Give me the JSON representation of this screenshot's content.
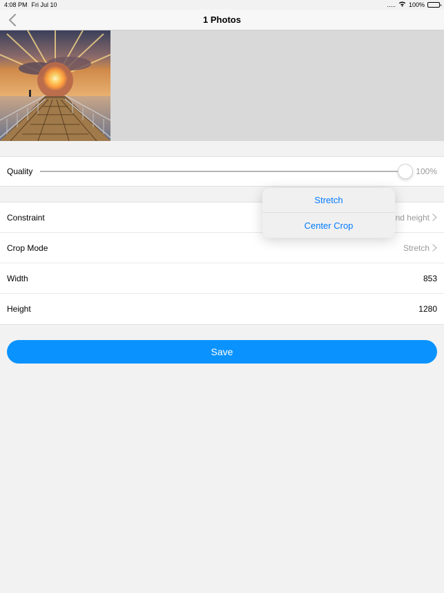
{
  "statusbar": {
    "time": "4:08 PM",
    "date": "Fri Jul 10",
    "signal_dots": ".....",
    "battery_pct": "100%"
  },
  "nav": {
    "title": "1 Photos"
  },
  "quality": {
    "label": "Quality",
    "value": "100%"
  },
  "rows": {
    "constraint": {
      "label": "Constraint",
      "value": "nd height"
    },
    "crop": {
      "label": "Crop Mode",
      "value": "Stretch"
    },
    "width": {
      "label": "Width",
      "value": "853"
    },
    "height": {
      "label": "Height",
      "value": "1280"
    }
  },
  "save_label": "Save",
  "popover": {
    "option1": "Stretch",
    "option2": "Center Crop"
  }
}
